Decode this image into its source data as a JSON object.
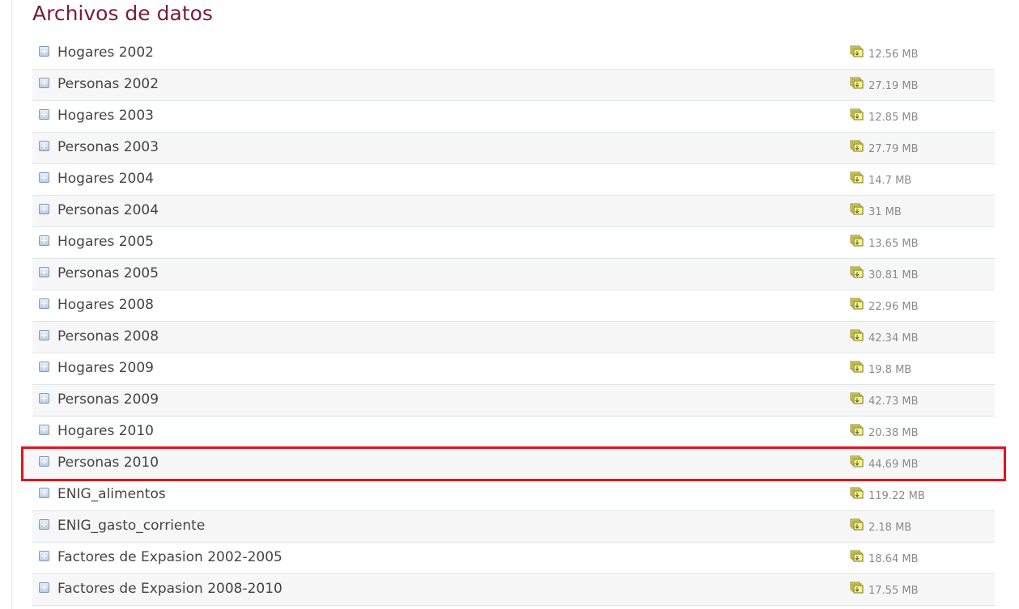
{
  "page": {
    "title": "Archivos de datos"
  },
  "colors": {
    "title": "#7a1a3c",
    "highlight_border": "#e8121a",
    "row_divider": "#dde7e7"
  },
  "files": [
    {
      "name": "Hogares 2002",
      "size": "12.56 MB",
      "icon": "expand-icon",
      "download_icon": "download-icon"
    },
    {
      "name": "Personas 2002",
      "size": "27.19 MB",
      "icon": "expand-icon",
      "download_icon": "download-icon"
    },
    {
      "name": "Hogares 2003",
      "size": "12.85 MB",
      "icon": "expand-icon",
      "download_icon": "download-icon"
    },
    {
      "name": "Personas 2003",
      "size": "27.79 MB",
      "icon": "expand-icon",
      "download_icon": "download-icon"
    },
    {
      "name": "Hogares 2004",
      "size": "14.7 MB",
      "icon": "expand-icon",
      "download_icon": "download-icon"
    },
    {
      "name": "Personas 2004",
      "size": "31 MB",
      "icon": "expand-icon",
      "download_icon": "download-icon"
    },
    {
      "name": "Hogares 2005",
      "size": "13.65 MB",
      "icon": "expand-icon",
      "download_icon": "download-icon"
    },
    {
      "name": "Personas 2005",
      "size": "30.81 MB",
      "icon": "expand-icon",
      "download_icon": "download-icon"
    },
    {
      "name": "Hogares 2008",
      "size": "22.96 MB",
      "icon": "expand-icon",
      "download_icon": "download-icon"
    },
    {
      "name": "Personas 2008",
      "size": "42.34 MB",
      "icon": "expand-icon",
      "download_icon": "download-icon"
    },
    {
      "name": "Hogares 2009",
      "size": "19.8 MB",
      "icon": "expand-icon",
      "download_icon": "download-icon"
    },
    {
      "name": "Personas 2009",
      "size": "42.73 MB",
      "icon": "expand-icon",
      "download_icon": "download-icon"
    },
    {
      "name": "Hogares 2010",
      "size": "20.38 MB",
      "icon": "expand-icon",
      "download_icon": "download-icon"
    },
    {
      "name": "Personas 2010",
      "size": "44.69 MB",
      "icon": "expand-icon",
      "download_icon": "download-icon",
      "highlighted": true
    },
    {
      "name": "ENIG_alimentos",
      "size": "119.22 MB",
      "icon": "expand-icon",
      "download_icon": "download-icon"
    },
    {
      "name": "ENIG_gasto_corriente",
      "size": "2.18 MB",
      "icon": "expand-icon",
      "download_icon": "download-icon"
    },
    {
      "name": "Factores de Expasion 2002-2005",
      "size": "18.64 MB",
      "icon": "expand-icon",
      "download_icon": "download-icon"
    },
    {
      "name": "Factores de Expasion 2008-2010",
      "size": "17.55 MB",
      "icon": "expand-icon",
      "download_icon": "download-icon"
    }
  ]
}
